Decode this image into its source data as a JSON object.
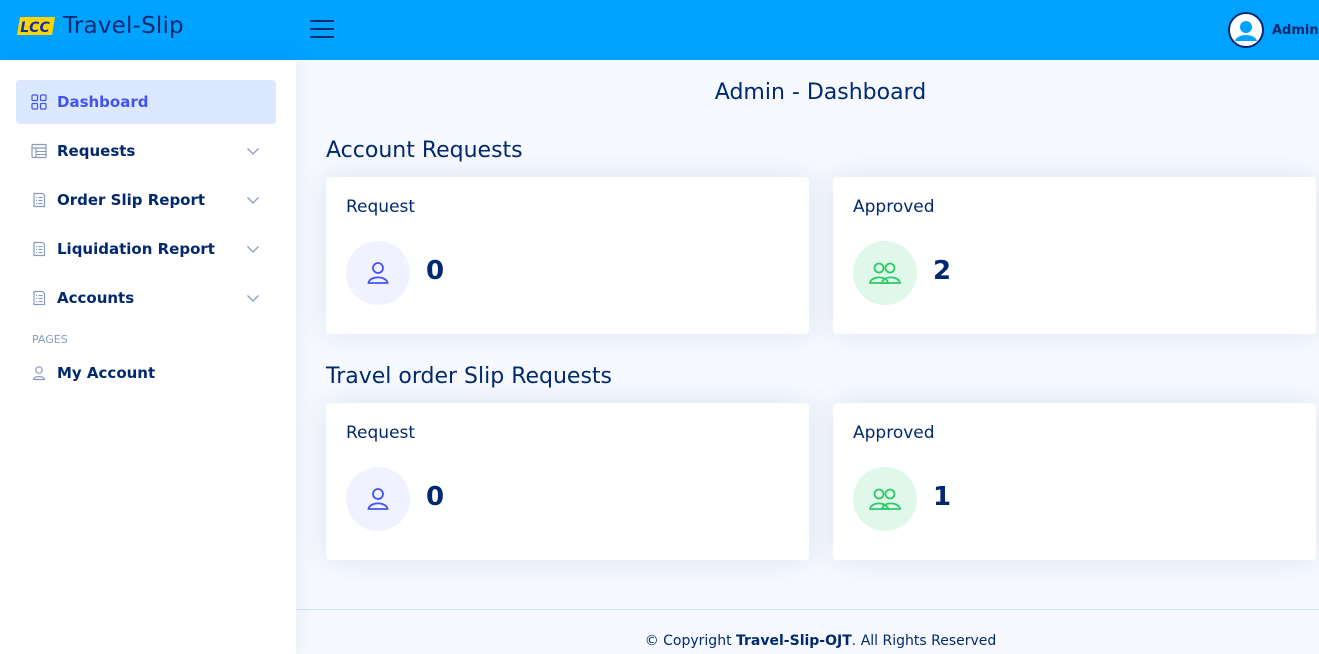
{
  "header": {
    "logo_mark": "LCC",
    "app_title": "Travel-Slip",
    "user_name": "Admin",
    "colors": {
      "header_bg": "#00a2ff",
      "text": "#012970",
      "logo_yellow": "#ffd400",
      "logo_blue": "#1030b0"
    }
  },
  "sidebar": {
    "items": [
      {
        "label": "Dashboard",
        "icon": "grid-icon",
        "active": true
      },
      {
        "label": "Requests",
        "icon": "table-icon",
        "expandable": true
      },
      {
        "label": "Order Slip Report",
        "icon": "report-icon",
        "expandable": true
      },
      {
        "label": "Liquidation Report",
        "icon": "report-icon",
        "expandable": true
      },
      {
        "label": "Accounts",
        "icon": "report-icon",
        "expandable": true
      }
    ],
    "pages_heading": "PAGES",
    "pages": [
      {
        "label": "My Account",
        "icon": "person-icon"
      }
    ]
  },
  "main": {
    "page_title": "Admin - Dashboard",
    "sections": [
      {
        "title": "Account Requests",
        "cards": [
          {
            "title": "Request",
            "value": "0",
            "icon": "person-icon",
            "color": "#4154f1"
          },
          {
            "title": "Approved",
            "value": "2",
            "icon": "people-icon",
            "color": "#2eca6a"
          }
        ]
      },
      {
        "title": "Travel order Slip Requests",
        "cards": [
          {
            "title": "Request",
            "value": "0",
            "icon": "person-icon",
            "color": "#4154f1"
          },
          {
            "title": "Approved",
            "value": "1",
            "icon": "people-icon",
            "color": "#2eca6a"
          }
        ]
      }
    ]
  },
  "footer": {
    "prefix": "© Copyright ",
    "brand": "Travel-Slip-OJT",
    "suffix": ". All Rights Reserved"
  }
}
